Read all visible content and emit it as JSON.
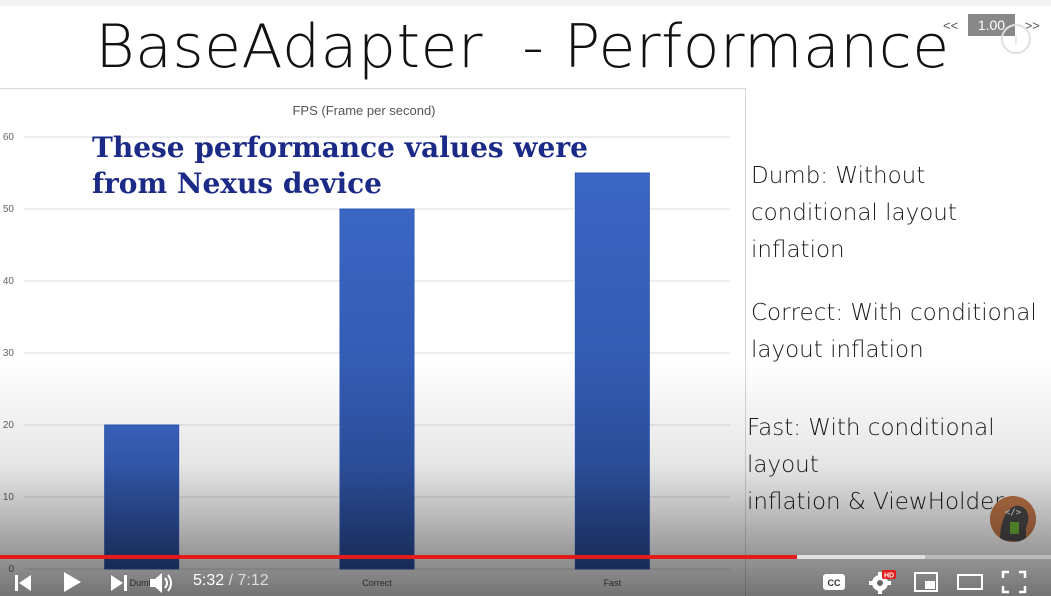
{
  "slide": {
    "title": "BaseAdapter  - Performance",
    "overlay_text": [
      "These performance values were",
      "from Nexus device"
    ],
    "notes": [
      [
        "Dumb: Without",
        "conditional layout inflation"
      ],
      [
        "Correct: With  conditional",
        "layout inflation"
      ],
      [
        "Fast: With  conditional layout",
        "inflation & ViewHolder"
      ]
    ]
  },
  "chart_data": {
    "type": "bar",
    "title": "FPS (Frame per second)",
    "categories": [
      "Dumb",
      "Correct",
      "Fast"
    ],
    "values": [
      20,
      50,
      55
    ],
    "ylim": [
      0,
      60
    ],
    "yticks": [
      0,
      10,
      20,
      30,
      40,
      50,
      60
    ],
    "grid": true,
    "bar_color": "#3b66c4"
  },
  "player": {
    "speed_label": "1.00",
    "speed_prev": "<<",
    "speed_next": ">>",
    "current_time": "5:32",
    "separator": " / ",
    "duration": "7:12",
    "progress_played": 0.758,
    "progress_loaded": 0.88,
    "hd_badge": "HD",
    "cc_label": "CC",
    "info_icon": "i",
    "accent_color": "#e41b1b"
  }
}
